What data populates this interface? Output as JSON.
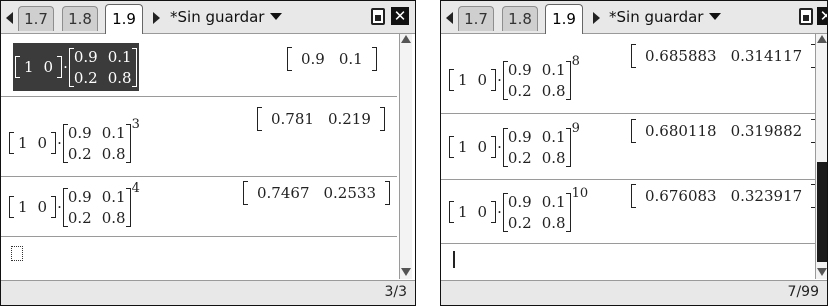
{
  "left": {
    "tabs": [
      "1.7",
      "1.8",
      "1.9"
    ],
    "active_tab": 2,
    "doc_title": "*Sin guardar",
    "entries": [
      {
        "row": [
          "1",
          "0"
        ],
        "matrix": [
          "0.9",
          "0.1",
          "0.2",
          "0.8"
        ],
        "exponent": "",
        "result": [
          "0.9",
          "0.1"
        ],
        "selected": true
      },
      {
        "row": [
          "1",
          "0"
        ],
        "matrix": [
          "0.9",
          "0.1",
          "0.2",
          "0.8"
        ],
        "exponent": "3",
        "result": [
          "0.781",
          "0.219"
        ]
      },
      {
        "row": [
          "1",
          "0"
        ],
        "matrix": [
          "0.9",
          "0.1",
          "0.2",
          "0.8"
        ],
        "exponent": "4",
        "result": [
          "0.7467",
          "0.2533"
        ]
      }
    ],
    "status": "3/3"
  },
  "right": {
    "tabs": [
      "1.7",
      "1.8",
      "1.9"
    ],
    "active_tab": 2,
    "doc_title": "*Sin guardar",
    "entries": [
      {
        "row": [
          "1",
          "0"
        ],
        "matrix": [
          "0.9",
          "0.1",
          "0.2",
          "0.8"
        ],
        "exponent": "8",
        "result": [
          "0.685883",
          "0.314117"
        ]
      },
      {
        "row": [
          "1",
          "0"
        ],
        "matrix": [
          "0.9",
          "0.1",
          "0.2",
          "0.8"
        ],
        "exponent": "9",
        "result": [
          "0.680118",
          "0.319882"
        ]
      },
      {
        "row": [
          "1",
          "0"
        ],
        "matrix": [
          "0.9",
          "0.1",
          "0.2",
          "0.8"
        ],
        "exponent": "10",
        "result": [
          "0.676083",
          "0.323917"
        ]
      }
    ],
    "status": "7/99"
  }
}
